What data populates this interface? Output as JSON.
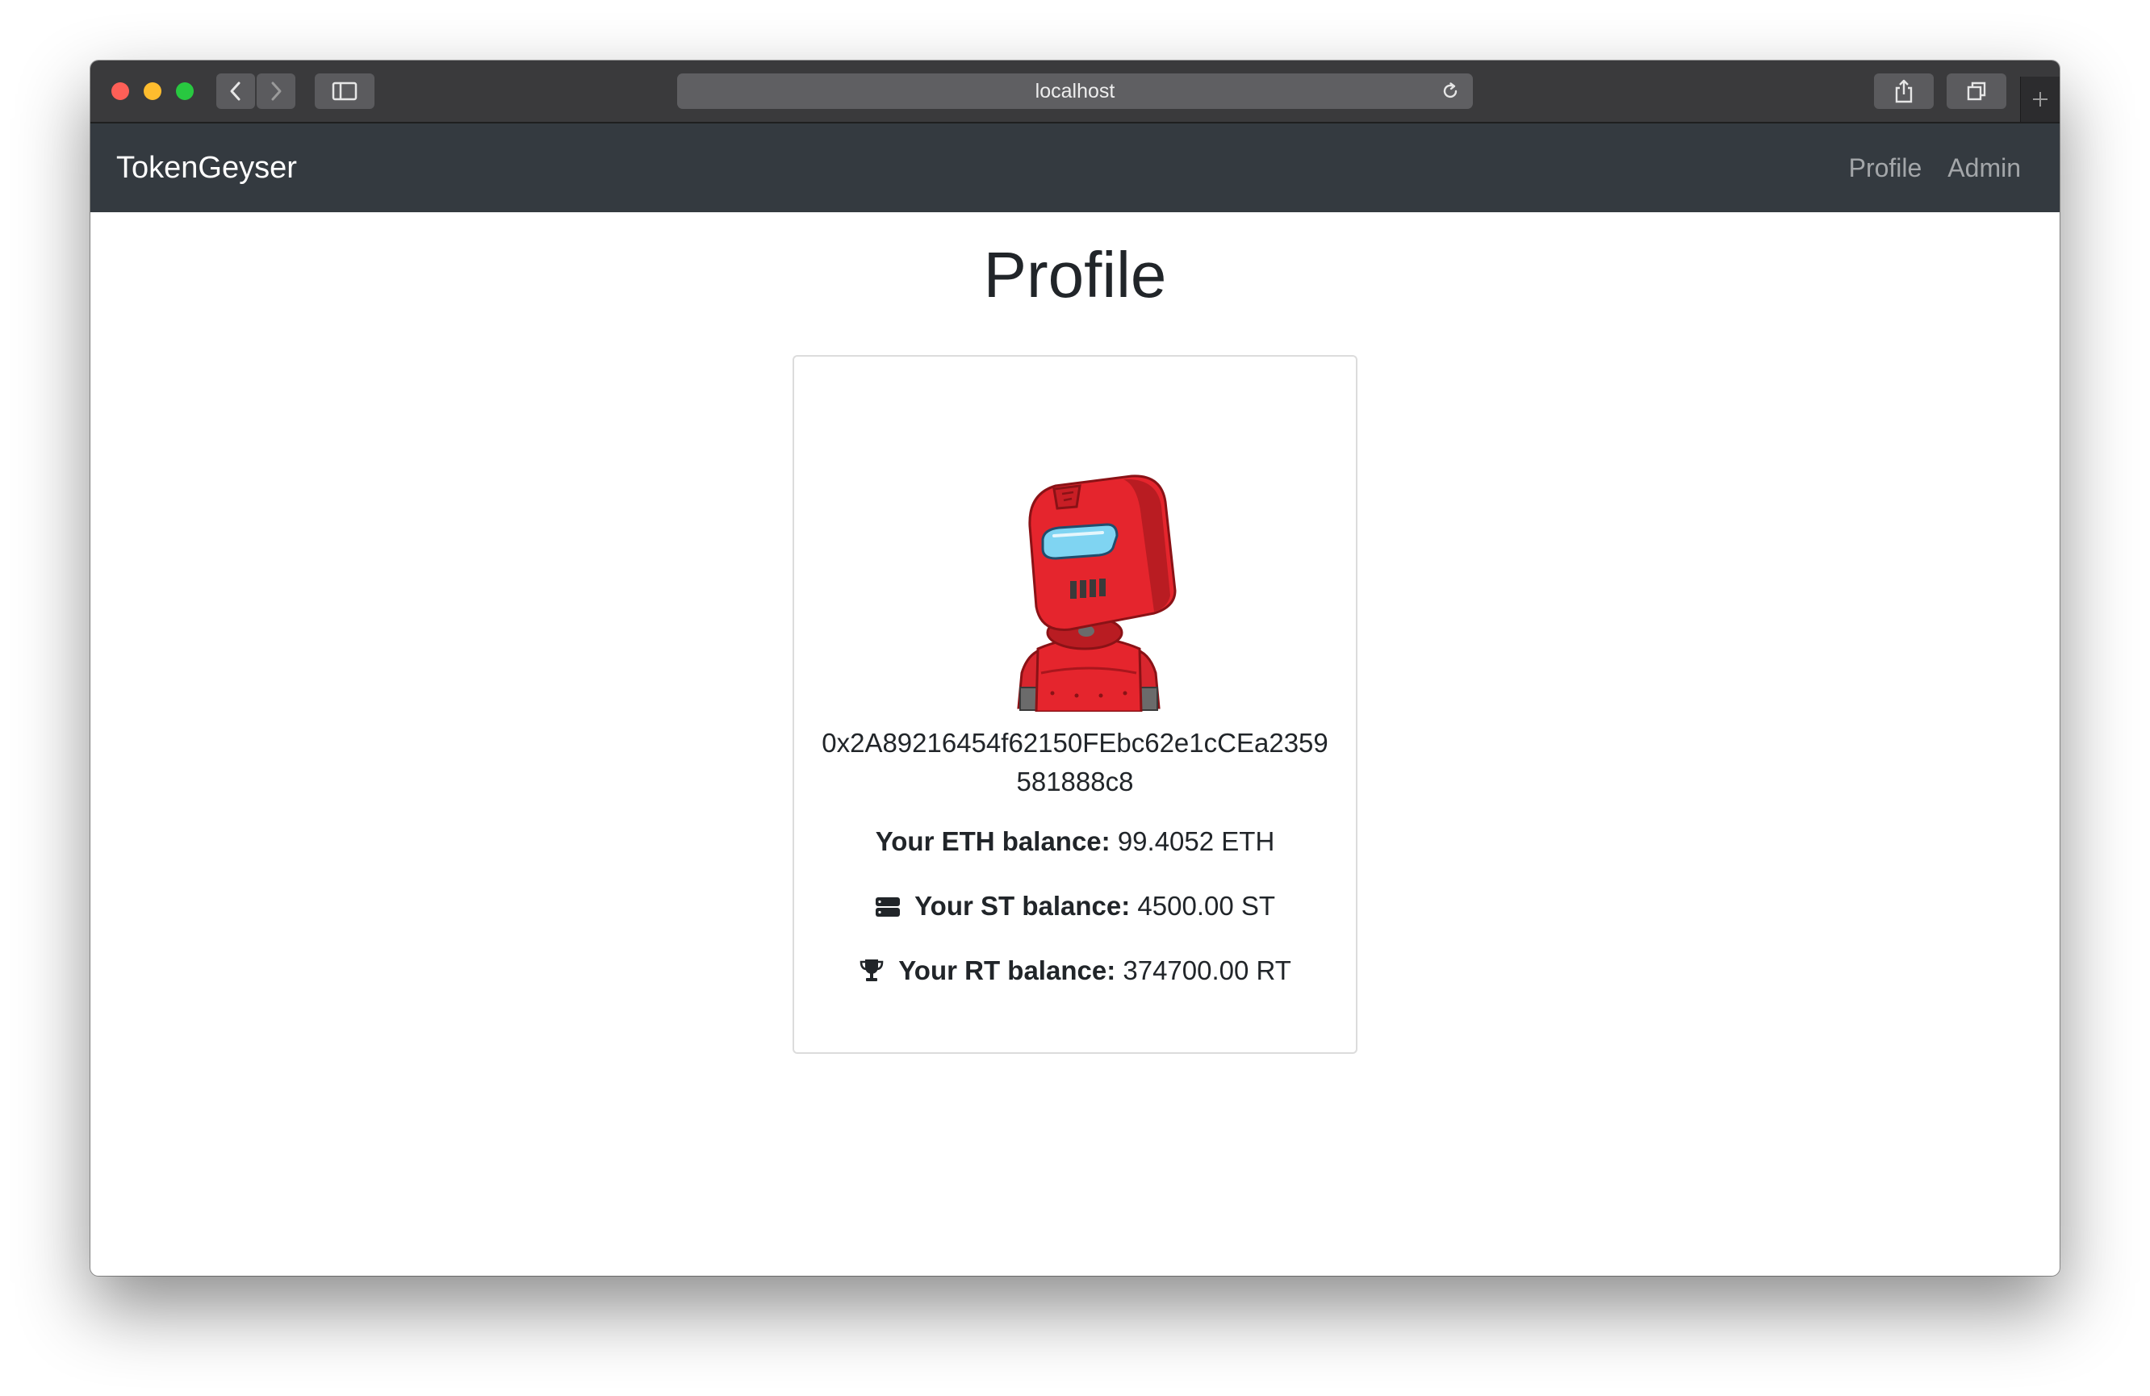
{
  "browser": {
    "url": "localhost"
  },
  "navbar": {
    "brand": "TokenGeyser",
    "links": [
      {
        "label": "Profile"
      },
      {
        "label": "Admin"
      }
    ]
  },
  "page": {
    "title": "Profile"
  },
  "profile": {
    "avatar_icon": "red-robot-avatar",
    "address": "0x2A89216454f62150FEbc62e1cCEa2359581888c8",
    "balances": [
      {
        "icon": "",
        "label": "Your ETH balance:",
        "value": "99.4052 ETH"
      },
      {
        "icon": "server-icon",
        "label": "Your ST balance:",
        "value": "4500.00 ST"
      },
      {
        "icon": "trophy-icon",
        "label": "Your RT balance:",
        "value": "374700.00 RT"
      }
    ]
  },
  "colors": {
    "navbar_bg": "#343a40",
    "text": "#212529",
    "robot_red": "#e5252d"
  }
}
